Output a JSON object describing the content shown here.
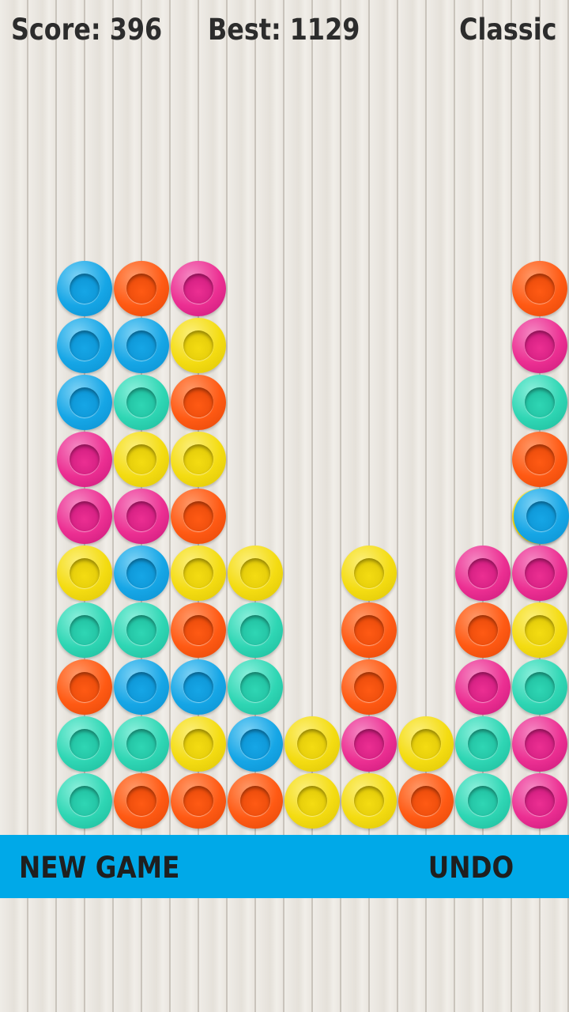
{
  "header": {
    "score": "Score: 396",
    "best": "Best: 1129",
    "mode": "Classic"
  },
  "toolbar": {
    "new_game_label": "NEW GAME",
    "undo_label": "UNDO"
  },
  "colors": {
    "B": {
      "name": "blue",
      "ring": "#16a6e6",
      "light": "#7fd3f6",
      "inner": "#0a8fcf"
    },
    "O": {
      "name": "orange",
      "ring": "#ff5a14",
      "light": "#ff9a6a",
      "inner": "#e24608"
    },
    "P": {
      "name": "magenta",
      "ring": "#ec2f92",
      "light": "#f58bc4",
      "inner": "#c8177a"
    },
    "Y": {
      "name": "yellow",
      "ring": "#f4dc12",
      "light": "#fcef7a",
      "inner": "#dcc406"
    },
    "T": {
      "name": "teal",
      "ring": "#2fd6b4",
      "light": "#8cf0dc",
      "inner": "#1cb89a"
    }
  },
  "board": {
    "rows": [
      "BOP.....O",
      "BBY.....P",
      "BTO.....T",
      "PYY.....O",
      "PPO.....YB",
      "YBYY.Y.PP",
      "TTOT.O.OY",
      "OBBT.O.PT",
      "TTYBYPYTP",
      "TOOOYYOTP"
    ]
  }
}
